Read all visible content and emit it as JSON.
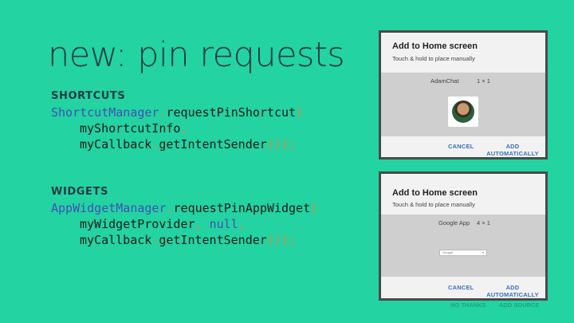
{
  "slide": {
    "title": "new: pin requests"
  },
  "shortcuts": {
    "heading": "SHORTCUTS",
    "line1_class": "ShortcutManager",
    "line1_dot": ".",
    "line1_method": "requestPinShortcut",
    "line1_paren": "(",
    "line2_arg": "myShortcutInfo",
    "line2_comma": ",",
    "line3_obj": "myCallback",
    "line3_dot": ".",
    "line3_method": "getIntentSender",
    "line3_close": "());"
  },
  "widgets": {
    "heading": "WIDGETS",
    "line1_class": "AppWidgetManager",
    "line1_dot": ".",
    "line1_method": "requestPinAppWidget",
    "line1_paren": "(",
    "line2_arg": "myWidgetProvider",
    "line2_comma": ",",
    "line2_null": "null",
    "line2_comma2": ",",
    "line3_obj": "myCallback",
    "line3_dot": ".",
    "line3_method": "getIntentSender",
    "line3_close": "());"
  },
  "dialog_shortcut": {
    "title": "Add to Home screen",
    "subtitle": "Touch & hold to place manually",
    "app_name": "AdamChat",
    "size": "1 × 1",
    "cancel": "CANCEL",
    "add": "ADD AUTOMATICALLY"
  },
  "dialog_widget": {
    "title": "Add to Home screen",
    "subtitle": "Touch & hold to place manually",
    "app_name": "Google App",
    "size": "4 × 1",
    "widget_text": "Google",
    "widget_dropdown": "▾",
    "cancel": "CANCEL",
    "add": "ADD AUTOMATICALLY",
    "ghost_left": "NO THANKS",
    "ghost_right": "ADD SOURCE"
  },
  "colors": {
    "background": "#23d3a2",
    "text_dark": "#1f3b44",
    "code_class": "#3f51b5",
    "code_punctuation": "#e08a3c",
    "dialog_button": "#3a6fc0"
  }
}
